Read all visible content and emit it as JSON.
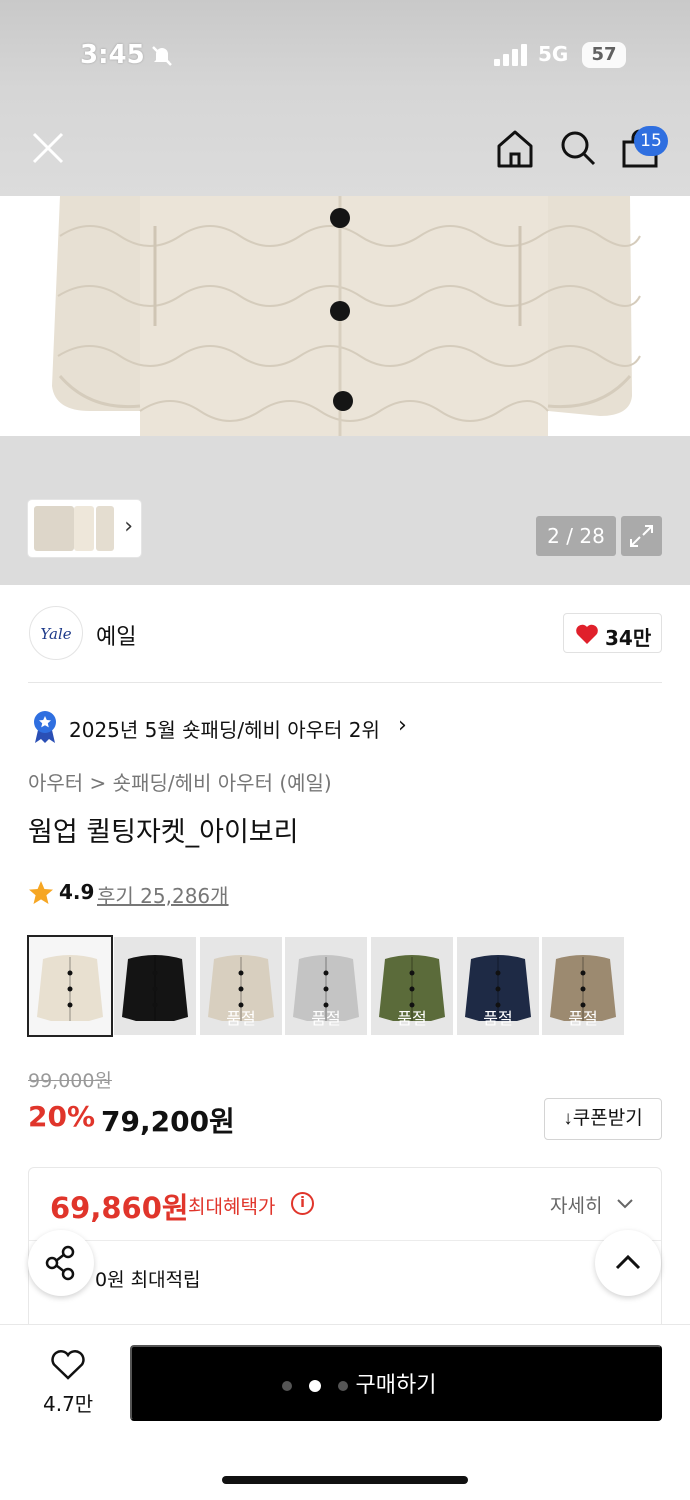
{
  "status_bar": {
    "time": "3:45",
    "network": "5G",
    "battery": "57"
  },
  "header": {
    "cart_count": "15"
  },
  "gallery": {
    "counter": "2 / 28"
  },
  "brand": {
    "logo_text": "Yale",
    "name": "예일",
    "likes": "34만"
  },
  "ranking": {
    "text": "2025년 5월 숏패딩/헤비 아우터 2위"
  },
  "breadcrumb": {
    "text": "아우터 > 숏패딩/헤비 아우터 (예일)"
  },
  "product": {
    "title": "웜업 퀼팅자켓_아이보리"
  },
  "rating": {
    "score": "4.9",
    "reviews": "후기 25,286개"
  },
  "swatches": [
    {
      "color": "#e8e0d0",
      "sold_out": ""
    },
    {
      "color": "#141414",
      "sold_out": ""
    },
    {
      "color": "#d8cfbf",
      "sold_out": "품절"
    },
    {
      "color": "#c4c4c4",
      "sold_out": "품절"
    },
    {
      "color": "#5b6b3a",
      "sold_out": "품절"
    },
    {
      "color": "#1e2a45",
      "sold_out": "품절"
    },
    {
      "color": "#9c8a70",
      "sold_out": "품절"
    }
  ],
  "price": {
    "original": "99,000원",
    "discount": "20%",
    "sale": "79,200원",
    "coupon_button": "↓쿠폰받기"
  },
  "benefit": {
    "max_price": "69,860원",
    "max_label": "최대혜택가",
    "info": "i",
    "detail_link": "자세히",
    "points": "0원 최대적립"
  },
  "bottom_bar": {
    "wish_count": "4.7만",
    "buy_label": "구매하기"
  },
  "colors": {
    "accent_red": "#e0352b",
    "badge_blue": "#2f6fe0",
    "buy_black": "#000000"
  }
}
